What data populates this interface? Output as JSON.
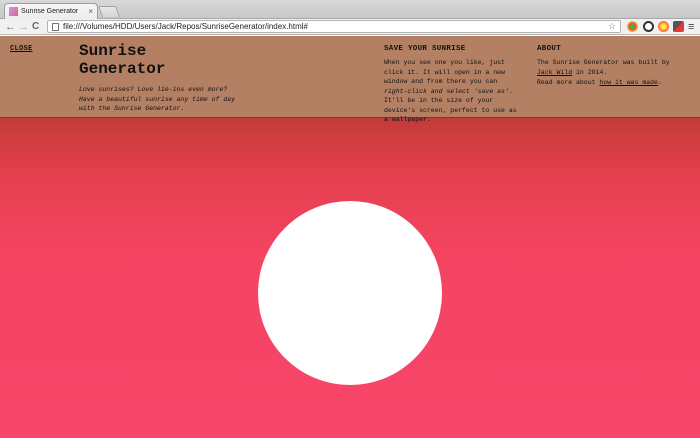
{
  "browser": {
    "tab_title": "Sunrise Generator",
    "tab_close": "×",
    "url": "file:///Volumes/HDD/Users/Jack/Repos/SunriseGenerator/index.html#",
    "back_glyph": "←",
    "forward_glyph": "→",
    "reload_glyph": "C",
    "star_glyph": "☆",
    "menu_glyph": "≡"
  },
  "page": {
    "close_label": "CLOSE",
    "title": "Sunrise Generator",
    "tagline": "Love sunrises? Love lie-ins even more? Have a beautiful sunrise any time of day with the Sunrise Generator.",
    "save": {
      "heading": "SAVE YOUR SUNRISE",
      "text_1": "When you see one you like, just click it. It will open in a new window and from there you can ",
      "text_italic": "right-click and select 'save as'",
      "text_2": ". It'll be in the size of your device's screen, perfect to use as a wallpaper."
    },
    "about": {
      "heading": "ABOUT",
      "text_1": "The Sunrise Generator was built by ",
      "author_link": "Jack Wild",
      "text_2": " in 2014.",
      "read_more_1": "Read more about ",
      "read_more_link": "how it was made",
      "read_more_2": "."
    }
  },
  "colors": {
    "panel": "#b48064",
    "sky_top": "#a9382c",
    "sky_bottom": "#f8456a",
    "sun": "#ffffff"
  }
}
